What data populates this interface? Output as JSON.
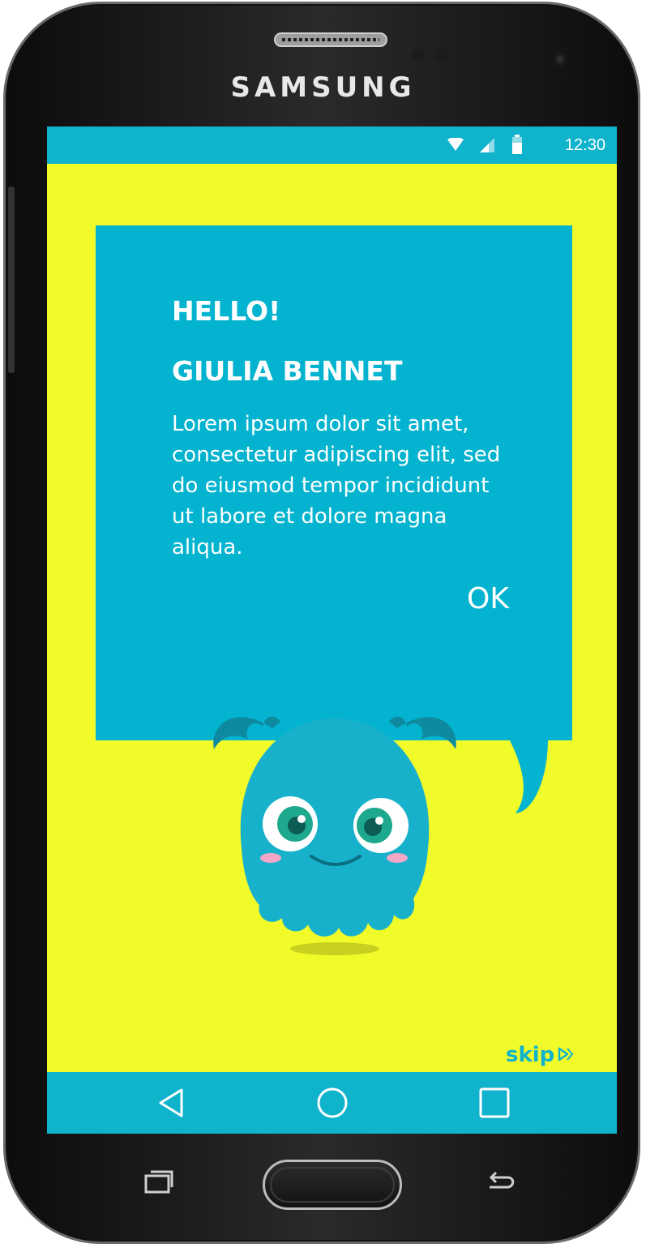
{
  "device": {
    "brand": "SAMSUNG"
  },
  "status_bar": {
    "time": "12:30",
    "icons": [
      "wifi-icon",
      "signal-icon",
      "battery-icon"
    ]
  },
  "dialog": {
    "greeting": "HELLO!",
    "name": "GIULIA BENNET",
    "message": "Lorem ipsum dolor sit amet, consectetur adipiscing elit, sed do eiusmod tempor incididunt ut labore et dolore magna aliqua.",
    "ok_label": "OK"
  },
  "skip": {
    "label": "skip"
  },
  "nav_bar": {
    "items": [
      "back-icon",
      "home-icon",
      "recents-icon"
    ]
  },
  "colors": {
    "background": "#f2fb2a",
    "accent": "#03b3cf",
    "text": "#ffffff"
  }
}
